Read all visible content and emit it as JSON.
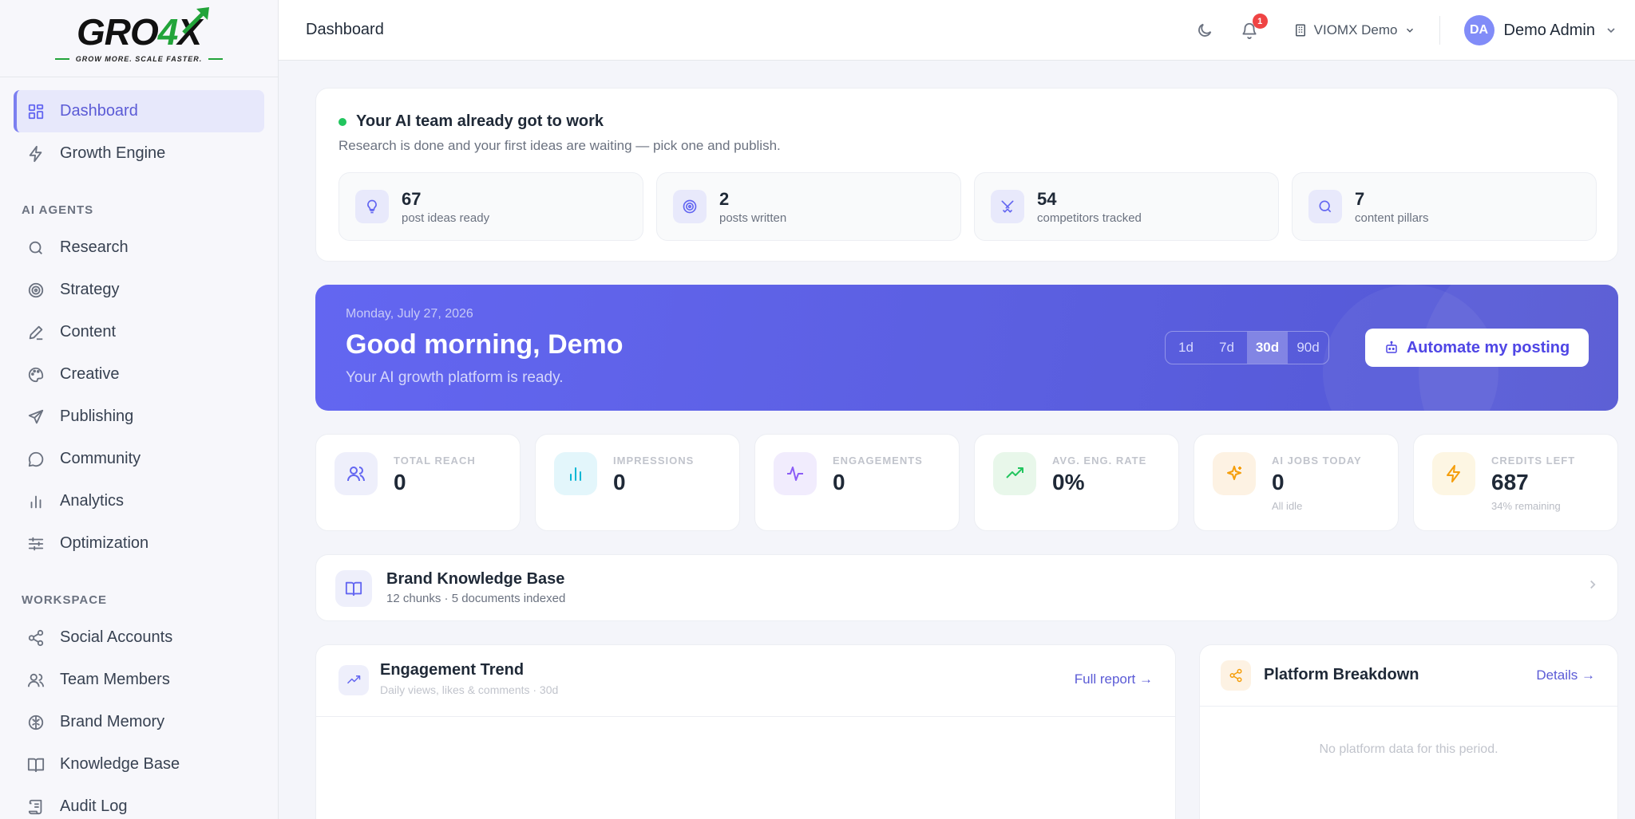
{
  "brand": {
    "logo_main": "GRO",
    "logo_four": "4",
    "logo_end": "X",
    "tagline": "GROW MORE. SCALE FASTER."
  },
  "sidebar": {
    "primary": [
      {
        "label": "Dashboard",
        "icon": "grid-icon",
        "active": true
      },
      {
        "label": "Growth Engine",
        "icon": "bolt-icon"
      }
    ],
    "section_agents": "AI AGENTS",
    "agents": [
      {
        "label": "Research",
        "icon": "search-icon"
      },
      {
        "label": "Strategy",
        "icon": "target-icon"
      },
      {
        "label": "Content",
        "icon": "pen-icon"
      },
      {
        "label": "Creative",
        "icon": "palette-icon"
      },
      {
        "label": "Publishing",
        "icon": "send-icon"
      },
      {
        "label": "Community",
        "icon": "chat-icon"
      },
      {
        "label": "Analytics",
        "icon": "bar-chart-icon"
      },
      {
        "label": "Optimization",
        "icon": "sliders-icon"
      }
    ],
    "section_workspace": "WORKSPACE",
    "workspace": [
      {
        "label": "Social Accounts",
        "icon": "share-icon"
      },
      {
        "label": "Team Members",
        "icon": "users-icon"
      },
      {
        "label": "Brand Memory",
        "icon": "brain-icon"
      },
      {
        "label": "Knowledge Base",
        "icon": "book-icon"
      },
      {
        "label": "Audit Log",
        "icon": "scroll-icon"
      }
    ]
  },
  "header": {
    "title": "Dashboard",
    "notification_count": "1",
    "org_name": "VIOMX Demo",
    "user_initials": "DA",
    "user_name": "Demo Admin"
  },
  "ai_card": {
    "title": "Your AI team already got to work",
    "subtitle": "Research is done and your first ideas are waiting — pick one and publish.",
    "stats": [
      {
        "value": "67",
        "label": "post ideas ready",
        "icon": "lightbulb-icon"
      },
      {
        "value": "2",
        "label": "posts written",
        "icon": "target-icon"
      },
      {
        "value": "54",
        "label": "competitors tracked",
        "icon": "swords-icon"
      },
      {
        "value": "7",
        "label": "content pillars",
        "icon": "search-icon"
      }
    ]
  },
  "hero": {
    "date": "Monday, July 27, 2026",
    "greeting": "Good morning, Demo",
    "subtitle": "Your AI growth platform is ready.",
    "ranges": [
      "1d",
      "7d",
      "30d",
      "90d"
    ],
    "active_range": "30d",
    "cta": "Automate my posting"
  },
  "kpis": [
    {
      "label": "TOTAL REACH",
      "value": "0",
      "note": "",
      "icon": "users-icon",
      "bg": "#eeeffb",
      "color": "#6366f1"
    },
    {
      "label": "IMPRESSIONS",
      "value": "0",
      "note": "",
      "icon": "bar-chart-icon",
      "bg": "#e3f6fb",
      "color": "#06b6d4"
    },
    {
      "label": "ENGAGEMENTS",
      "value": "0",
      "note": "",
      "icon": "activity-icon",
      "bg": "#f1ecfd",
      "color": "#8b5cf6"
    },
    {
      "label": "AVG. ENG. RATE",
      "value": "0%",
      "note": "",
      "icon": "trending-up-icon",
      "bg": "#e8f7ea",
      "color": "#22c55e"
    },
    {
      "label": "AI JOBS TODAY",
      "value": "0",
      "note": "All idle",
      "icon": "sparkles-icon",
      "bg": "#fdf2e3",
      "color": "#f59e0b"
    },
    {
      "label": "CREDITS LEFT",
      "value": "687",
      "note": "34% remaining",
      "icon": "bolt-icon",
      "bg": "#fdf6e3",
      "color": "#f59e0b"
    }
  ],
  "knowledge": {
    "title": "Brand Knowledge Base",
    "subtitle": "12 chunks · 5 documents indexed"
  },
  "trend": {
    "title": "Engagement Trend",
    "subtitle": "Daily views, likes & comments · 30d",
    "link": "Full report →"
  },
  "platform": {
    "title": "Platform Breakdown",
    "link": "Details →",
    "empty": "No platform data for this period."
  }
}
